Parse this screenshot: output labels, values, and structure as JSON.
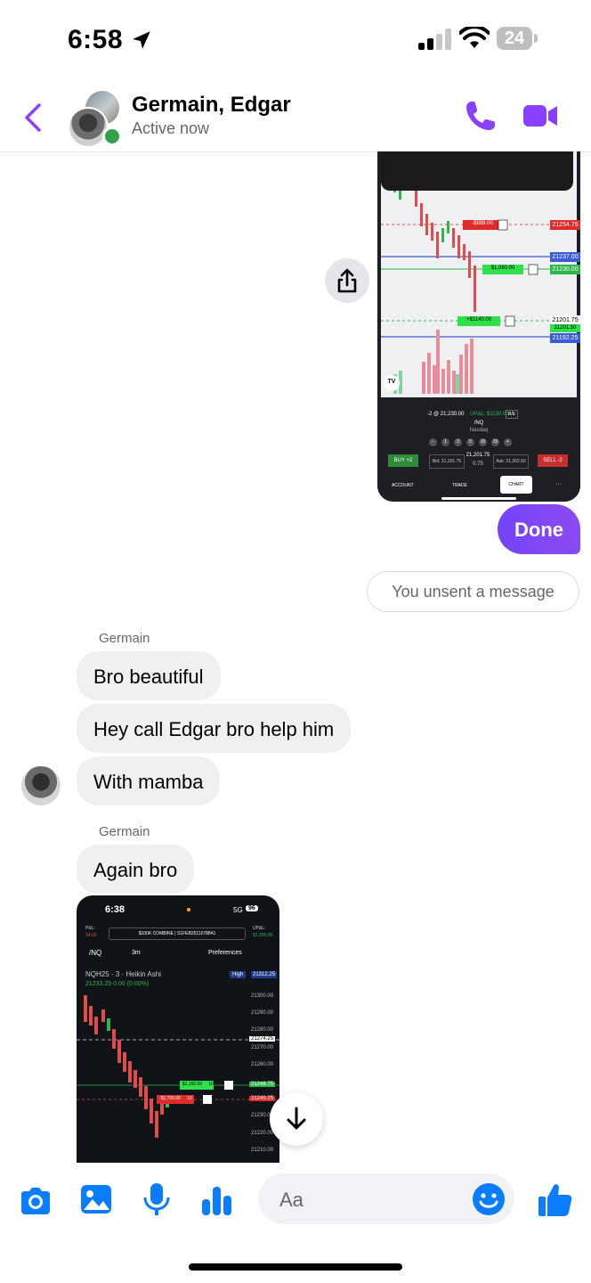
{
  "status_bar": {
    "time": "6:58",
    "battery": "24"
  },
  "header": {
    "name": "Germain, Edgar",
    "status": "Active now"
  },
  "screenshot1": {
    "prices": [
      "21254.75",
      "21237.00",
      "21230.00",
      "21201.75",
      "21201.50",
      "21192.25"
    ],
    "orders": [
      "-$898.00",
      "$1,060.00",
      "+$1140.00"
    ],
    "position": "-2 @ 21,230.00",
    "upl": "UP&L: $1130.00",
    "be": "B/E",
    "symbol": "/NQ",
    "exchange": "Nasdaq",
    "qty": [
      "−",
      "1",
      "3",
      "5",
      "10",
      "15",
      "+"
    ],
    "bid": "Bid: 21,201.75",
    "last": "21,201.75",
    "change": "0.75",
    "ask": "Ask: 21,202.50",
    "buy": "BUY +2",
    "sell": "SELL -2",
    "nav": [
      "ACCOUNT",
      "TRADE",
      "CHART",
      "···"
    ],
    "tv": "TV"
  },
  "messages": {
    "done": "Done",
    "unsent": "You unsent a message",
    "sender1": "Germain",
    "msg1": "Bro beautiful",
    "msg2": "Hey call Edgar bro help him",
    "msg3": "With mamba",
    "sender2": "Germain",
    "msg4": "Again bro"
  },
  "screenshot2": {
    "time": "6:38",
    "network": "5G",
    "battery": "96",
    "pl_label": "P&L:",
    "pl_value": "14.00",
    "account": "$100K COMBINE | S1FEB2511078841",
    "upl_label": "UP&L:",
    "upl_value": "$1,200.00",
    "symbol": "/NQ",
    "interval": "3m",
    "preferences": "Preferences",
    "title": "NQH25 · 3 · Heikin Ashi",
    "quote": "21233.25  0.00 (0.00%)",
    "high": "High",
    "high_price": "21312.25",
    "prices": [
      "21300.00",
      "21290.00",
      "21280.00",
      "21274.25",
      "21270.00",
      "21260.00",
      "21248.75",
      "21240.25",
      "21230.00",
      "21220.00",
      "21210.00"
    ],
    "order1": "$1,150.00",
    "order1_qty": "10",
    "order2": "-$1,700.00",
    "order2_qty": "10"
  },
  "composer": {
    "placeholder": "Aa"
  },
  "colors": {
    "accent": "#8a3ffc",
    "bubble_out": "#7b45f6",
    "blue": "#0a7cff"
  },
  "icons": [
    "location-arrow-icon",
    "signal-icon",
    "wifi-icon",
    "battery-icon",
    "back-chevron-icon",
    "phone-icon",
    "video-camera-icon",
    "share-icon",
    "arrow-down-icon",
    "camera-icon",
    "photo-icon",
    "microphone-icon",
    "audio-bars-icon",
    "emoji-icon",
    "thumbs-up-icon"
  ]
}
